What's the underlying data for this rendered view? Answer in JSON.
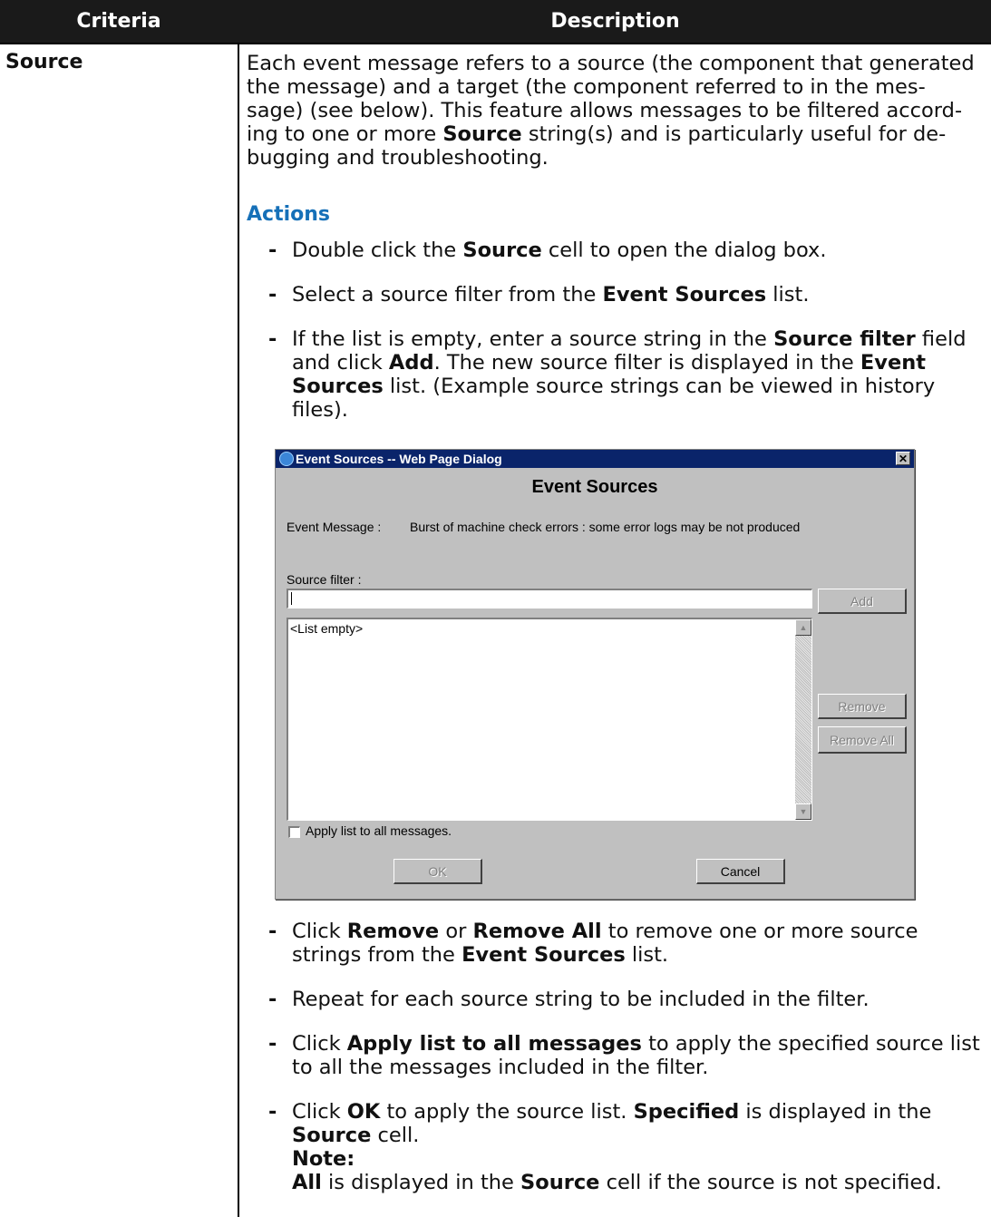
{
  "table": {
    "header_criteria": "Criteria",
    "header_description": "Description",
    "criteria": "Source"
  },
  "intro": {
    "line1": "Each event message refers to a source (the component that generated",
    "line2": "the message) and a target (the component referred to in the mes-",
    "line3": "sage) (see below). This feature allows messages to be filtered accord-",
    "line4_a": "ing to one or more ",
    "line4_b": "Source",
    "line4_c": " string(s) and is particularly useful for de-",
    "line5": "bugging and troubleshooting."
  },
  "actions_heading": "Actions",
  "bullets": {
    "dash": "-",
    "b1": {
      "a": "Double click the ",
      "b": "Source",
      "c": " cell to open the dialog box."
    },
    "b2": {
      "a": "Select a source filter from the ",
      "b": "Event Sources",
      "c": " list."
    },
    "b3": {
      "a": "If the list is empty, enter a source string in the ",
      "b": "Source filter",
      "c": " field",
      "d": "and click ",
      "e": "Add",
      "f": ". The new source filter is displayed in the ",
      "g": "Event",
      "h": "Sources",
      "i": " list. (Example source strings can be viewed in history",
      "j": "files)."
    },
    "b4": {
      "a": "Click ",
      "b": "Remove",
      "c": " or ",
      "d": "Remove All",
      "e": " to remove one or more source",
      "f": "strings from the ",
      "g": "Event Sources",
      "h": " list."
    },
    "b5": {
      "a": "Repeat for each source string to be included in the filter."
    },
    "b6": {
      "a": "Click ",
      "b": "Apply list to all messages",
      "c": " to apply the specified source list",
      "d": "to all the messages included in the filter."
    },
    "b7": {
      "a": "Click ",
      "b": "OK",
      "c": " to apply the source list. ",
      "d": "Specified",
      "e": " is displayed in the",
      "f": "Source",
      "g": " cell.",
      "note": "Note:",
      "h": "All",
      "i": " is displayed in the ",
      "j": "Source",
      "k": " cell if the source is not specified."
    }
  },
  "dialog": {
    "title": "Event Sources -- Web Page Dialog",
    "close": "✕",
    "heading": "Event Sources",
    "message_label": "Event Message :",
    "message_value": "Burst of machine check errors : some error logs may be not produced",
    "filter_label": "Source filter :",
    "filter_value": "",
    "add_button": "Add",
    "list_empty": "<List empty>",
    "remove_button": "Remove",
    "remove_all_button": "Remove All",
    "apply_checkbox_label": "Apply list to all messages.",
    "apply_checked": false,
    "ok_button": "OK",
    "cancel_button": "Cancel"
  }
}
